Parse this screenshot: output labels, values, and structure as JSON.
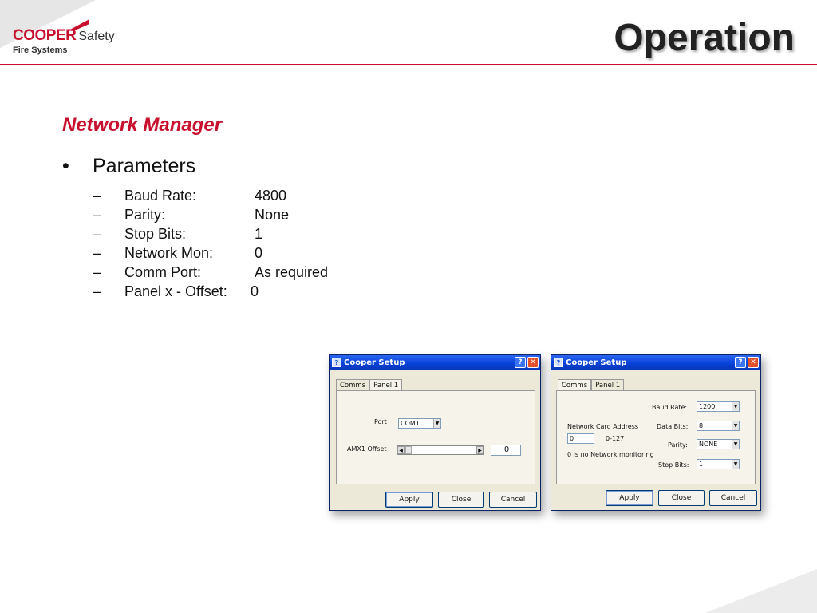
{
  "header": {
    "logo_brand": "COOPER",
    "logo_brand2": "Safety",
    "logo_sub": "Fire Systems",
    "title": "Operation"
  },
  "content": {
    "section_title": "Network Manager",
    "bullet": "Parameters",
    "params": [
      {
        "label": "Baud Rate:",
        "value": "4800"
      },
      {
        "label": "Parity:",
        "value": "None"
      },
      {
        "label": "Stop Bits:",
        "value": "1"
      },
      {
        "label": "Network Mon:",
        "value": "0"
      },
      {
        "label": "Comm Port:",
        "value": "As required"
      },
      {
        "label": "Panel x - Offset:",
        "value": "0"
      }
    ]
  },
  "dialog1": {
    "title": "Cooper Setup",
    "tabs": [
      "Comms",
      "Panel 1"
    ],
    "port_label": "Port",
    "port_value": "COM1",
    "offset_label": "AMX1 Offset",
    "offset_value": "0",
    "buttons": {
      "apply": "Apply",
      "close": "Close",
      "cancel": "Cancel"
    }
  },
  "dialog2": {
    "title": "Cooper Setup",
    "tabs": [
      "Comms",
      "Panel 1"
    ],
    "baud_label": "Baud Rate:",
    "baud_value": "1200",
    "data_bits_label": "Data Bits:",
    "data_bits_value": "8",
    "parity_label": "Parity:",
    "parity_value": "NONE",
    "stop_bits_label": "Stop Bits:",
    "stop_bits_value": "1",
    "net_addr_label": "Network Card Address",
    "net_addr_value": "0",
    "net_addr_range": "0-127",
    "net_note": "0 is no Network monitoring",
    "buttons": {
      "apply": "Apply",
      "close": "Close",
      "cancel": "Cancel"
    }
  },
  "colors": {
    "accent": "#c8102e",
    "titlebar": "#0841d8"
  }
}
